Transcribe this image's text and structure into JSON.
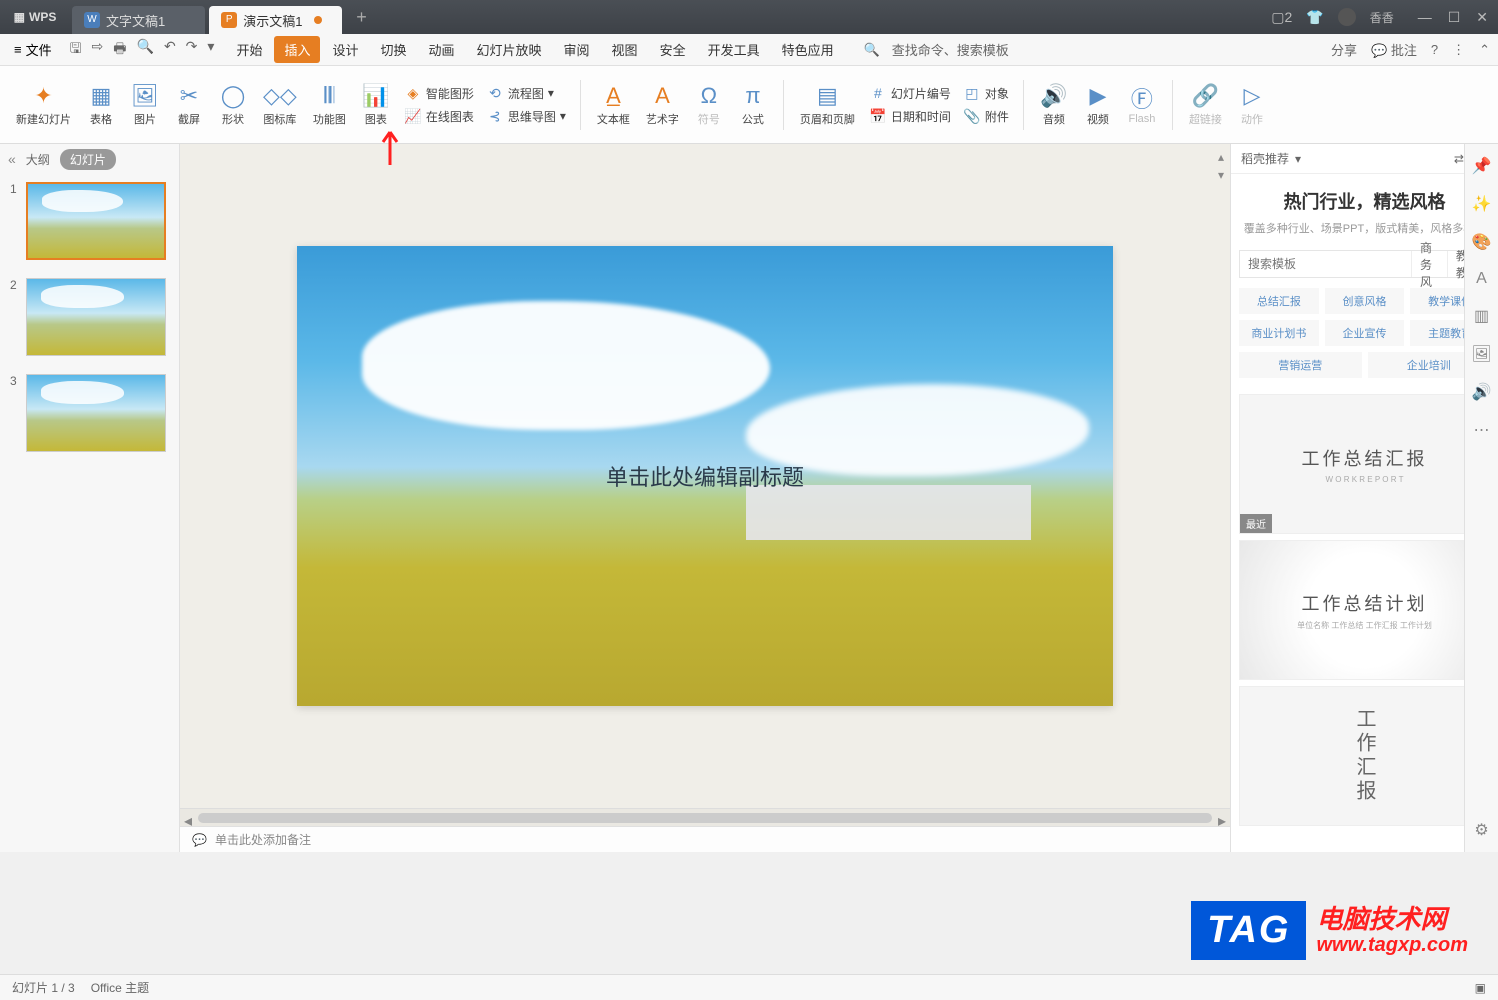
{
  "titlebar": {
    "app": "WPS",
    "tab1": "文字文稿1",
    "tab2": "演示文稿1",
    "user": "香香"
  },
  "menubar": {
    "file": "文件",
    "tabs": [
      "开始",
      "插入",
      "设计",
      "切换",
      "动画",
      "幻灯片放映",
      "审阅",
      "视图",
      "安全",
      "开发工具",
      "特色应用"
    ],
    "search": "查找命令、搜索模板",
    "share": "分享",
    "comment": "批注"
  },
  "ribbon": {
    "new_slide": "新建幻灯片",
    "table": "表格",
    "picture": "图片",
    "screenshot": "截屏",
    "shape": "形状",
    "icon_lib": "图标库",
    "func_chart": "功能图",
    "chart": "图表",
    "smart_art": "智能图形",
    "online_chart": "在线图表",
    "flowchart": "流程图",
    "mindmap": "思维导图",
    "textbox": "文本框",
    "wordart": "艺术字",
    "symbol": "符号",
    "equation": "公式",
    "header_footer": "页眉和页脚",
    "slide_num": "幻灯片编号",
    "datetime": "日期和时间",
    "object": "对象",
    "attachment": "附件",
    "audio": "音频",
    "video": "视频",
    "flash": "Flash",
    "hyperlink": "超链接",
    "action": "动作"
  },
  "slidepanel": {
    "outline": "大纲",
    "slides": "幻灯片",
    "slide_nums": [
      "1",
      "2",
      "3"
    ]
  },
  "canvas": {
    "subtitle_placeholder": "单击此处编辑副标题",
    "notes_placeholder": "单击此处添加备注"
  },
  "rightpane": {
    "header": "稻壳推荐",
    "title": "热门行业，精选风格",
    "subtitle": "覆盖多种行业、场景PPT，版式精美，风格多样！",
    "search_placeholder": "搜索模板",
    "search_tags": [
      "商务风",
      "教育教学"
    ],
    "categories": [
      "总结汇报",
      "创意风格",
      "教学课件",
      "商业计划书",
      "企业宣传",
      "主题教育",
      "营销运营",
      "企业培训"
    ],
    "template1_title": "工作总结汇报",
    "template1_sub": "W O R K   R E P O R T",
    "template1_badge": "最近",
    "template2_title": "工作总结计划",
    "template2_sub": "单位名称  工作总结  工作汇报  工作计划",
    "template3_line1": "工",
    "template3_line2": "作汇",
    "template3_line3": "报"
  },
  "statusbar": {
    "slide_info": "幻灯片 1 / 3",
    "theme": "Office 主题"
  },
  "watermark": {
    "tag": "TAG",
    "line1": "电脑技术网",
    "line2": "www.tagxp.com"
  }
}
